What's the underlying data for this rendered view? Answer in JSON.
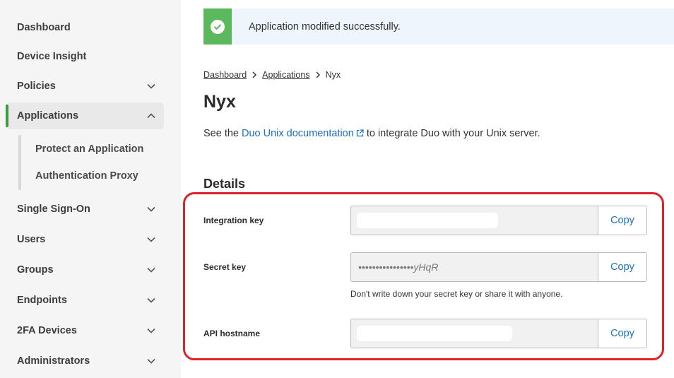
{
  "sidebar": {
    "items": [
      {
        "label": "Dashboard",
        "chevron": "none"
      },
      {
        "label": "Device Insight",
        "chevron": "none"
      },
      {
        "label": "Policies",
        "chevron": "down"
      },
      {
        "label": "Applications",
        "chevron": "up",
        "active": true
      },
      {
        "label": "Single Sign-On",
        "chevron": "down"
      },
      {
        "label": "Users",
        "chevron": "down"
      },
      {
        "label": "Groups",
        "chevron": "down"
      },
      {
        "label": "Endpoints",
        "chevron": "down"
      },
      {
        "label": "2FA Devices",
        "chevron": "down"
      },
      {
        "label": "Administrators",
        "chevron": "down"
      }
    ],
    "subitems": [
      {
        "label": "Protect an Application"
      },
      {
        "label": "Authentication Proxy"
      }
    ]
  },
  "banner": {
    "message": "Application modified successfully.",
    "icon": "check-circle-icon",
    "color": "#5cb85c"
  },
  "breadcrumb": {
    "items": [
      "Dashboard",
      "Applications",
      "Nyx"
    ]
  },
  "page": {
    "title": "Nyx",
    "intro_before": "See the ",
    "intro_link": "Duo Unix documentation",
    "intro_after": " to integrate Duo with your Unix server."
  },
  "details": {
    "title": "Details",
    "fields": [
      {
        "label": "Integration key",
        "value": "",
        "redacted": true,
        "copy_label": "Copy"
      },
      {
        "label": "Secret key",
        "value": "••••••••••••••••yHqR",
        "redacted": false,
        "copy_label": "Copy"
      },
      {
        "label": "API hostname",
        "value": "",
        "redacted": true,
        "copy_label": "Copy"
      }
    ],
    "secret_hint": "Don't write down your secret key or share it with anyone."
  },
  "colors": {
    "accent_link": "#1a6fc2",
    "active_bar": "#3d9a3d",
    "highlight_border": "#e0202a"
  }
}
